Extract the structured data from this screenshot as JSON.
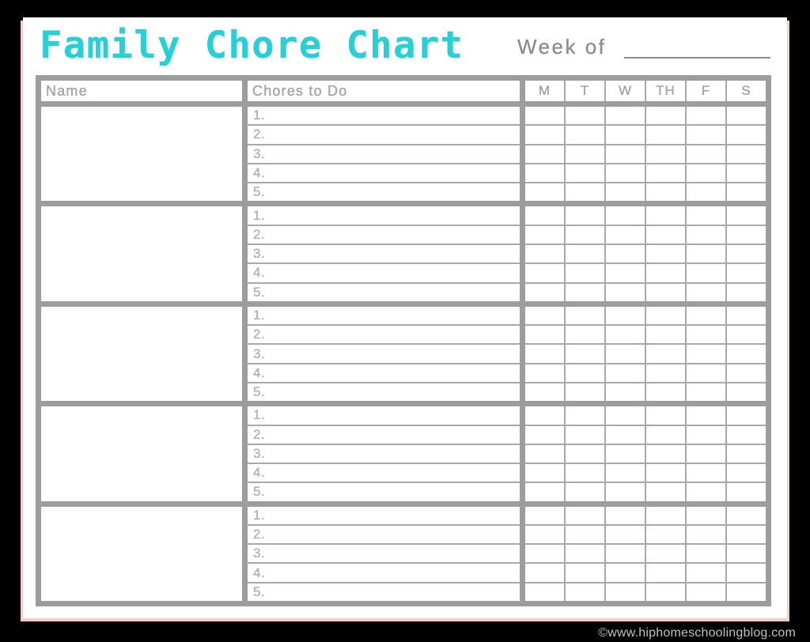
{
  "header": {
    "title": "Family Chore Chart",
    "week_of_label": "Week of",
    "week_of_value": "",
    "title_color": "#29cfd4"
  },
  "table": {
    "columns": {
      "name_header": "Name",
      "chores_header": "Chores to Do"
    },
    "day_headers": [
      "M",
      "T",
      "W",
      "TH",
      "F",
      "S"
    ],
    "chore_numbers": [
      "1.",
      "2.",
      "3.",
      "4.",
      "5."
    ],
    "person_rows": [
      {
        "name": "",
        "chores": [
          "",
          "",
          "",
          "",
          ""
        ]
      },
      {
        "name": "",
        "chores": [
          "",
          "",
          "",
          "",
          ""
        ]
      },
      {
        "name": "",
        "chores": [
          "",
          "",
          "",
          "",
          ""
        ]
      },
      {
        "name": "",
        "chores": [
          "",
          "",
          "",
          "",
          ""
        ]
      },
      {
        "name": "",
        "chores": [
          "",
          "",
          "",
          "",
          ""
        ]
      }
    ]
  },
  "footer": {
    "credit": "©www.hiphomeschoolingblog.com"
  },
  "theme": {
    "border_black": "#000000",
    "border_pink": "#fbc9c9",
    "grid_gray": "#9d9d9d",
    "rule_gray": "#a9a9a9",
    "text_gray": "#a8a8a8",
    "sheet_white": "#ffffff"
  }
}
